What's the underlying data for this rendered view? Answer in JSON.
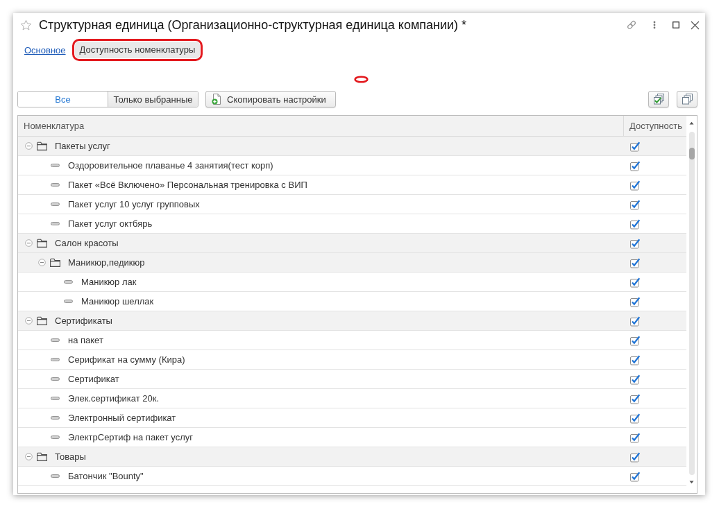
{
  "window": {
    "title": "Структурная единица (Организационно-структурная единица компании) *"
  },
  "tabs": [
    {
      "label": "Основное",
      "selected": false,
      "highlighted": false
    },
    {
      "label": "Доступность номенклатуры",
      "selected": true,
      "highlighted": true
    }
  ],
  "toolbar": {
    "filter": [
      {
        "label": "Все",
        "selected": true
      },
      {
        "label": "Только выбранные",
        "selected": false
      }
    ],
    "copy_button": "Скопировать настройки"
  },
  "table": {
    "columns": [
      "Номенклатура",
      "Доступность"
    ],
    "rows": [
      {
        "kind": "group",
        "label": "Пакеты услуг",
        "expanded": true,
        "checked": true,
        "children": [
          {
            "kind": "item",
            "label": "Оздоровительное плаванье 4 занятия(тест корп)",
            "checked": true
          },
          {
            "kind": "item",
            "label": "Пакет «Всё Включено» Персональная тренировка с ВИП",
            "checked": true
          },
          {
            "kind": "item",
            "label": "Пакет услуг 10 услуг групповых",
            "checked": true
          },
          {
            "kind": "item",
            "label": "Пакет услуг октбярь",
            "checked": true
          }
        ]
      },
      {
        "kind": "group",
        "label": "Салон красоты",
        "expanded": true,
        "checked": true,
        "children": [
          {
            "kind": "group",
            "label": "Маникюр,педикюр",
            "expanded": true,
            "checked": true,
            "children": [
              {
                "kind": "item",
                "label": "Маникюр лак",
                "checked": true
              },
              {
                "kind": "item",
                "label": "Маникюр шеллак",
                "checked": true
              }
            ]
          }
        ]
      },
      {
        "kind": "group",
        "label": "Сертификаты",
        "expanded": true,
        "checked": true,
        "children": [
          {
            "kind": "item",
            "label": "на пакет",
            "checked": true
          },
          {
            "kind": "item",
            "label": "Серификат на сумму (Кира)",
            "checked": true
          },
          {
            "kind": "item",
            "label": "Сертификат",
            "checked": true
          },
          {
            "kind": "item",
            "label": "Элек.сертификат 20к.",
            "checked": true
          },
          {
            "kind": "item",
            "label": "Электронный сертификат",
            "checked": true
          },
          {
            "kind": "item",
            "label": "ЭлектрСертиф на пакет услуг",
            "checked": true
          }
        ]
      },
      {
        "kind": "group",
        "label": "Товары",
        "expanded": true,
        "checked": true,
        "children": [
          {
            "kind": "item",
            "label": "Батончик \"Bounty\"",
            "checked": true
          }
        ]
      }
    ]
  }
}
